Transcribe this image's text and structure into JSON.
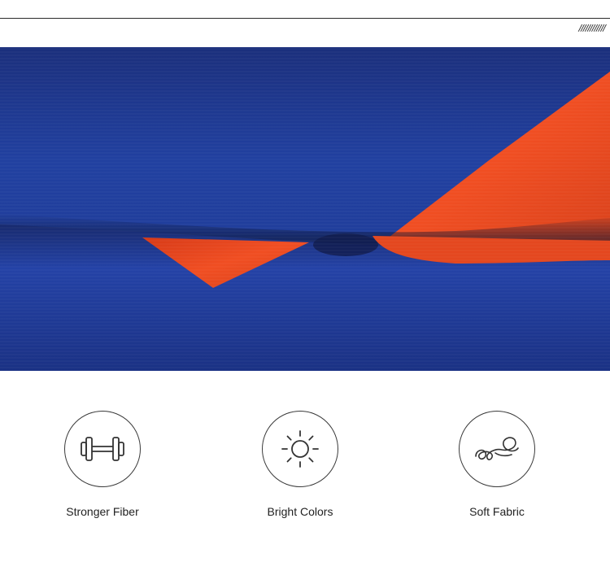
{
  "header": {
    "decoration": "////////////"
  },
  "hero": {
    "image": "blue-orange-fabric-closeup",
    "colors": {
      "blue": "#1f3a93",
      "orange": "#e8481e"
    }
  },
  "features": [
    {
      "label": "Stronger Fiber",
      "icon": "dumbbell-icon"
    },
    {
      "label": "Bright Colors",
      "icon": "sun-icon"
    },
    {
      "label": "Soft Fabric",
      "icon": "soft-swirl-icon"
    }
  ]
}
